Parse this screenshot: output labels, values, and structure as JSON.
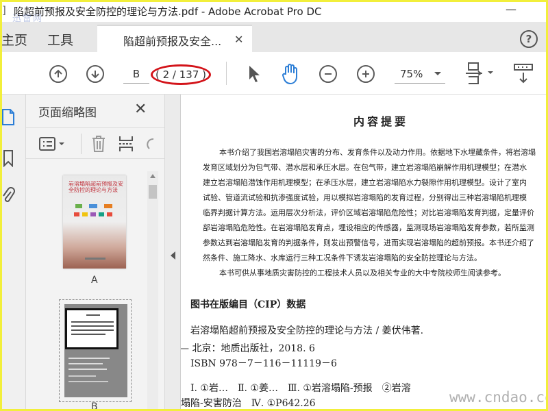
{
  "window": {
    "app_mark": "]",
    "title": "陷超前预报及安全防控的理论与方法.pdf - Adobe Acrobat Pro DC",
    "watermark_top": "迅雷网"
  },
  "tabs": {
    "home": "主页",
    "tools": "工具",
    "document": "陷超前预报及安全...",
    "help": "?"
  },
  "toolbar": {
    "page_input": "B",
    "page_count": "( 2 / 137 )",
    "zoom": "75%"
  },
  "thumbnails_panel": {
    "title": "页面缩略图",
    "thumb_a_label": "A",
    "thumb_b_label": "B",
    "thumb_a_title": "岩溶塌陷超前预报及安全防控的理论与方法"
  },
  "document": {
    "heading": "内容提要",
    "paragraphs": [
      "本书介绍了我国岩溶塌陷灾害的分布、发育条件以及动力作用。依据地下水埋藏条件，将岩溶塌",
      "发育区域划分为包气带、潜水层和承压水层。在包气带，建立岩溶塌陷崩解作用机理模型；在潜水",
      "建立岩溶塌陷潜蚀作用机理模型；在承压水层，建立岩溶塌陷水力裂隙作用机理模型。设计了室内",
      "试验、管道流试验和抗渗强度试验，用以模拟岩溶塌陷的发育过程，分别得出三种岩溶塌陷机理模",
      "临界判据计算方法。运用层次分析法，评价区域岩溶塌陷危险性；对比岩溶塌陷发育判据，定量评价",
      "部岩溶塌陷危险性。在岩溶塌陷发育点，埋设相应的传感器，监测现场岩溶塌陷发育参数，若所监测",
      "参数达到岩溶塌陷发育的判据条件，则发出预警信号，进而实现岩溶塌陷的超前预报。本书还介绍了",
      "然条件、施工降水、水库运行三种工况条件下诱发岩溶塌陷的安全防控理论与方法。",
      "本书可供从事地质灾害防控的工程技术人员以及相关专业的大中专院校师生阅读参考。"
    ],
    "cip_heading": "图书在版编目（CIP）数据",
    "cip_lines": [
      "岩溶塌陷超前预报及安全防控的理论与方法 / 姜伏伟著.",
      "— 北京：地质出版社，2018. 6",
      "ISBN 978－7－116－11119－6",
      "Ⅰ. ①岩…　Ⅱ. ①姜…　Ⅲ. ①岩溶塌陷-预报　②岩溶",
      "塌陷-安害防治　Ⅳ. ①P642.26"
    ]
  },
  "watermark_bottom": "www.cndao.com",
  "colors": {
    "highlight_frame": "#f2ef3b",
    "annotation_circle": "#d3141a",
    "hand_tool_active": "#2c7ed6"
  }
}
